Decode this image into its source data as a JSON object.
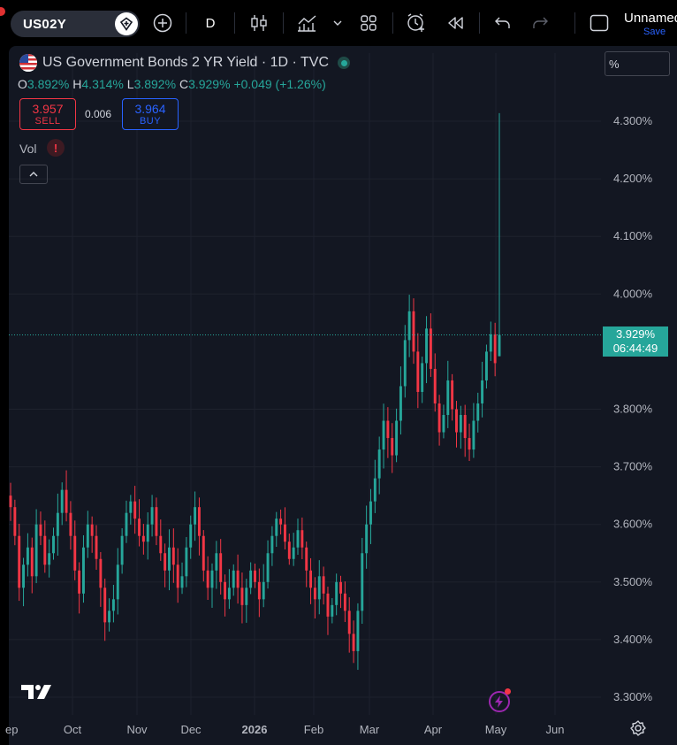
{
  "toolbar": {
    "symbol": "US02Y",
    "interval": "D",
    "layout_name": "Unnamed",
    "save_label": "Save",
    "icons": [
      "plus-circle-icon",
      "candles-icon",
      "indicators-icon",
      "chevron-down-icon",
      "templates-icon",
      "alert-icon",
      "replay-icon",
      "undo-icon",
      "redo-icon",
      "fullscreen-icon"
    ]
  },
  "legend": {
    "title": "US Government Bonds 2 YR Yield · 1D · TVC",
    "open_label": "O",
    "open": "3.892%",
    "high_label": "H",
    "high": "4.314%",
    "low_label": "L",
    "low": "3.892%",
    "close_label": "C",
    "close": "3.929%",
    "change": "+0.049 (+1.26%)",
    "sell_price": "3.957",
    "sell_label": "SELL",
    "spread": "0.006",
    "buy_price": "3.964",
    "buy_label": "BUY",
    "vol_label": "Vol",
    "vol_warning": "!"
  },
  "price_axis": {
    "unit": "%",
    "last_price": "3.929%",
    "countdown": "06:44:49"
  },
  "colors": {
    "up": "#26a69a",
    "down": "#f23645",
    "background": "#131722",
    "grid": "#1e222d",
    "text": "#b2b5be"
  },
  "chart_data": {
    "type": "candlestick",
    "title": "US Government Bonds 2 YR Yield · 1D · TVC",
    "ylim": [
      3.28,
      4.38
    ],
    "yticks": [
      "4.300%",
      "4.200%",
      "4.100%",
      "4.000%",
      "3.800%",
      "3.700%",
      "3.600%",
      "3.500%",
      "3.400%",
      "3.300%"
    ],
    "xticks": [
      "ep",
      "Oct",
      "Nov",
      "Dec",
      "2026",
      "Feb",
      "Mar",
      "Apr",
      "May",
      "Jun"
    ],
    "last_price": 3.929,
    "grid": true,
    "series": [
      {
        "name": "",
        "close": [
          3.63,
          3.58,
          3.49,
          3.53,
          3.56,
          3.51,
          3.6,
          3.58,
          3.53,
          3.55,
          3.58,
          3.62,
          3.66,
          3.62,
          3.58,
          3.52,
          3.48,
          3.56,
          3.6,
          3.58,
          3.54,
          3.49,
          3.43,
          3.45,
          3.47,
          3.53,
          3.58,
          3.62,
          3.64,
          3.61,
          3.58,
          3.57,
          3.6,
          3.63,
          3.58,
          3.55,
          3.52,
          3.56,
          3.53,
          3.49,
          3.51,
          3.56,
          3.6,
          3.63,
          3.58,
          3.52,
          3.49,
          3.52,
          3.55,
          3.5,
          3.47,
          3.49,
          3.52,
          3.49,
          3.46,
          3.49,
          3.52,
          3.5,
          3.47,
          3.5,
          3.55,
          3.58,
          3.61,
          3.6,
          3.57,
          3.54,
          3.56,
          3.59,
          3.56,
          3.52,
          3.49,
          3.47,
          3.51,
          3.48,
          3.44,
          3.46,
          3.5,
          3.48,
          3.45,
          3.41,
          3.38,
          3.45,
          3.55,
          3.6,
          3.64,
          3.68,
          3.73,
          3.78,
          3.75,
          3.72,
          3.78,
          3.84,
          3.92,
          3.97,
          3.9,
          3.83,
          3.88,
          3.94,
          3.87,
          3.81,
          3.76,
          3.79,
          3.85,
          3.8,
          3.76,
          3.79,
          3.75,
          3.73,
          3.78,
          3.81,
          3.85,
          3.9,
          3.93,
          3.88,
          3.929
        ]
      }
    ]
  }
}
